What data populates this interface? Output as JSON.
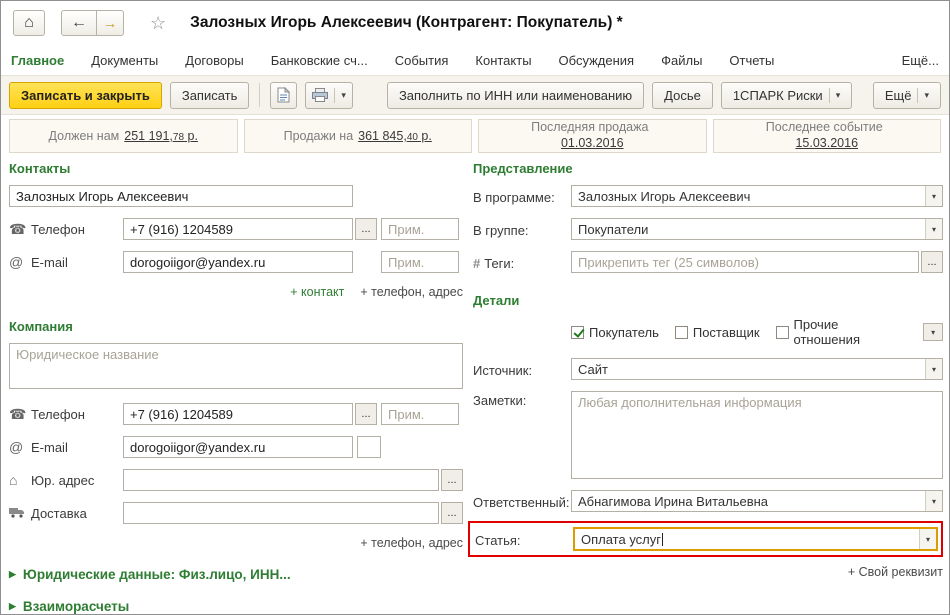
{
  "colors": {
    "accent_green": "#2e7d32",
    "primary_yellow": "#ffd013",
    "focus_orange": "#dd9c00",
    "annotation_red": "#e10000"
  },
  "ui": {
    "ellipsis": "...",
    "caret_down": "▾",
    "expander_arrow": "▶",
    "back_arrow": "←",
    "forward_arrow": "→",
    "home_glyph": "⌂",
    "star_glyph": "☆",
    "phone_glyph": "☎",
    "at_glyph": "@",
    "house_glyph": "⌂",
    "hash_glyph": "#"
  },
  "titlebar": {
    "title": "Залозных Игорь Алексеевич (Контрагент: Покупатель) *"
  },
  "tabs": {
    "items": [
      {
        "label": "Главное"
      },
      {
        "label": "Документы"
      },
      {
        "label": "Договоры"
      },
      {
        "label": "Банковские сч..."
      },
      {
        "label": "События"
      },
      {
        "label": "Контакты"
      },
      {
        "label": "Обсуждения"
      },
      {
        "label": "Файлы"
      },
      {
        "label": "Отчеты"
      },
      {
        "label": "Ещё..."
      }
    ]
  },
  "toolbar": {
    "save_close": "Записать и закрыть",
    "save": "Записать",
    "fill_inn": "Заполнить по ИНН или наименованию",
    "dossier": "Досье",
    "spark": "1СПАРК Риски",
    "more": "Ещё"
  },
  "summary": {
    "debt_label": "Должен нам",
    "debt_int": "251 191,",
    "debt_frac": "78",
    "debt_cur": " р.",
    "sales_label": "Продажи на",
    "sales_int": "361 845,",
    "sales_frac": "40",
    "sales_cur": " р.",
    "last_sale_label": "Последняя продажа",
    "last_sale_date": "01.03.2016",
    "last_event_label": "Последнее событие",
    "last_event_date": "15.03.2016"
  },
  "contacts": {
    "header": "Контакты",
    "name_value": "Залозных Игорь Алексеевич",
    "phone_label": "Телефон",
    "phone_value": "+7 (916) 1204589",
    "note_placeholder": "Прим.",
    "email_label": "E-mail",
    "email_value": "dorogoiigor@yandex.ru",
    "add_contact": "+ контакт",
    "add_phone_addr": "+ телефон, адрес"
  },
  "company": {
    "header": "Компания",
    "legal_name_placeholder": "Юридическое название",
    "phone_label": "Телефон",
    "phone_value": "+7 (916) 1204589",
    "note_placeholder": "Прим.",
    "email_label": "E-mail",
    "email_value": "dorogoiigor@yandex.ru",
    "legal_addr_label": "Юр. адрес",
    "delivery_label": "Доставка",
    "add_phone_addr": "+ телефон, адрес"
  },
  "expanders": {
    "legal": "Юридические данные: Физ.лицо, ИНН...",
    "mutual": "Взаиморасчеты"
  },
  "representation": {
    "header": "Представление",
    "in_program_label": "В программе:",
    "in_program_value": "Залозных Игорь Алексеевич",
    "in_group_label": "В группе:",
    "in_group_value": "Покупатели",
    "tags_label": "Теги:",
    "tags_placeholder": "Прикрепить тег (25 символов)"
  },
  "details": {
    "header": "Детали",
    "cb_buyer": "Покупатель",
    "cb_supplier": "Поставщик",
    "cb_other": "Прочие отношения",
    "source_label": "Источник:",
    "source_value": "Сайт",
    "notes_label": "Заметки:",
    "notes_placeholder": "Любая дополнительная информация",
    "responsible_label": "Ответственный:",
    "responsible_value": "Абнагимова Ирина Витальевна",
    "article_label": "Статья:",
    "article_value": "Оплата услуг",
    "add_custom": "+ Свой реквизит"
  }
}
